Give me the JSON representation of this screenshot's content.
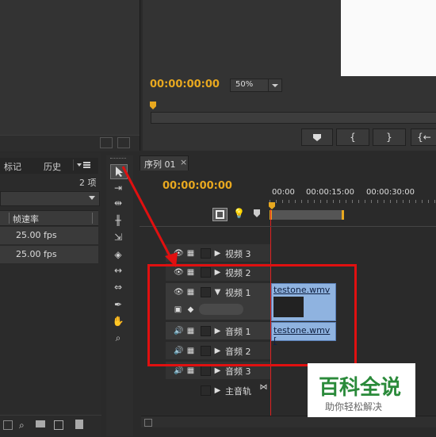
{
  "program_monitor": {
    "timecode": "00:00:00:00",
    "zoom": "50%",
    "buttons": [
      "{",
      "}",
      "{←"
    ]
  },
  "project_panel": {
    "tabs": [
      "标记",
      "历史"
    ],
    "item_count": "2 项",
    "column_header": "帧速率",
    "rows": [
      {
        "fps": "25.00 fps"
      },
      {
        "fps": "25.00 fps"
      }
    ]
  },
  "sequence": {
    "tab_label": "序列 01",
    "close": "×",
    "timecode": "00:00:00:00",
    "ruler_ticks": [
      "00:00",
      "00:00:15:00",
      "00:00:30:00"
    ],
    "tracks": [
      {
        "name": "视频 3"
      },
      {
        "name": "视频 2"
      },
      {
        "name": "视频 1"
      },
      {
        "name": "音频 1"
      },
      {
        "name": "音频 2"
      },
      {
        "name": "音频 3"
      },
      {
        "name": "主音轨"
      }
    ],
    "clips": {
      "video": "testone.wmv [",
      "audio": "testone.wmv ["
    }
  },
  "watermark": {
    "title": "百科全说",
    "subtitle": "助你轻松解决"
  },
  "colors": {
    "timecode": "#e8a81f",
    "clip": "#8fb3e0",
    "highlight_box": "#e01010",
    "watermark_title": "#2a8a3a"
  }
}
